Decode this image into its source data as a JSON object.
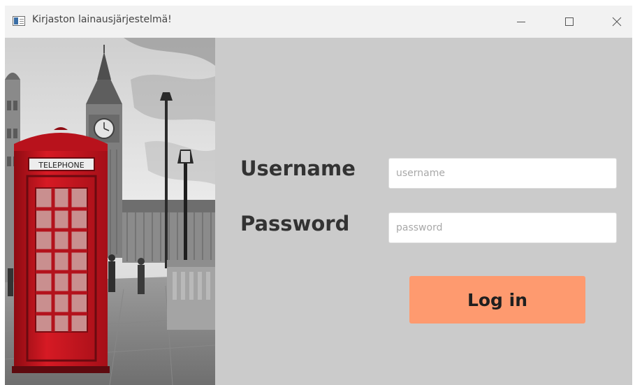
{
  "window": {
    "title": "Kirjaston lainausjärjestelmä!",
    "controls": [
      "minimize-icon",
      "maximize-icon",
      "close-icon"
    ]
  },
  "login": {
    "username_label": "Username",
    "username_placeholder": "username",
    "username_value": "",
    "password_label": "Password",
    "password_placeholder": "password",
    "password_value": "",
    "login_button": "Log in"
  },
  "colors": {
    "background": "#cbcbcb",
    "button": "#fe9a6f",
    "phone_booth": "#d0141f"
  }
}
